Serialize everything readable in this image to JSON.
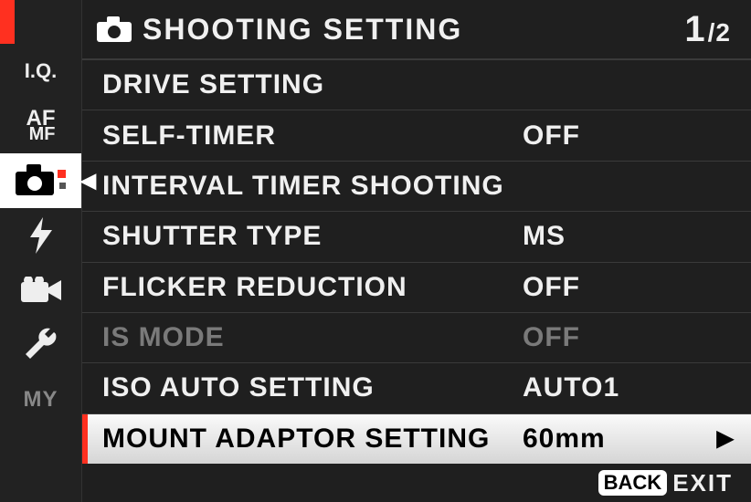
{
  "header": {
    "title": "SHOOTING SETTING",
    "page_current": "1",
    "page_total": "/2"
  },
  "sidebar": {
    "items": [
      {
        "label": "I.Q.",
        "kind": "text"
      },
      {
        "label_top": "AF",
        "label_bottom": "MF",
        "kind": "afmf"
      },
      {
        "kind": "camera",
        "selected": true
      },
      {
        "kind": "flash"
      },
      {
        "kind": "movie"
      },
      {
        "kind": "wrench"
      },
      {
        "label": "MY",
        "kind": "my"
      }
    ]
  },
  "menu": {
    "items": [
      {
        "label": "DRIVE SETTING",
        "value": "",
        "disabled": false,
        "selected": false
      },
      {
        "label": "SELF-TIMER",
        "value": "OFF",
        "disabled": false,
        "selected": false
      },
      {
        "label": "INTERVAL TIMER SHOOTING",
        "value": "",
        "disabled": false,
        "selected": false
      },
      {
        "label": "SHUTTER TYPE",
        "value": "MS",
        "disabled": false,
        "selected": false
      },
      {
        "label": "FLICKER REDUCTION",
        "value": "OFF",
        "disabled": false,
        "selected": false
      },
      {
        "label": "IS MODE",
        "value": "OFF",
        "disabled": true,
        "selected": false
      },
      {
        "label": "ISO AUTO SETTING",
        "value": "AUTO1",
        "disabled": false,
        "selected": false
      },
      {
        "label": "MOUNT ADAPTOR SETTING",
        "value": "60mm",
        "disabled": false,
        "selected": true
      }
    ]
  },
  "footer": {
    "back_label": "BACK",
    "exit_label": "EXIT"
  },
  "colors": {
    "accent": "#ff3020"
  }
}
